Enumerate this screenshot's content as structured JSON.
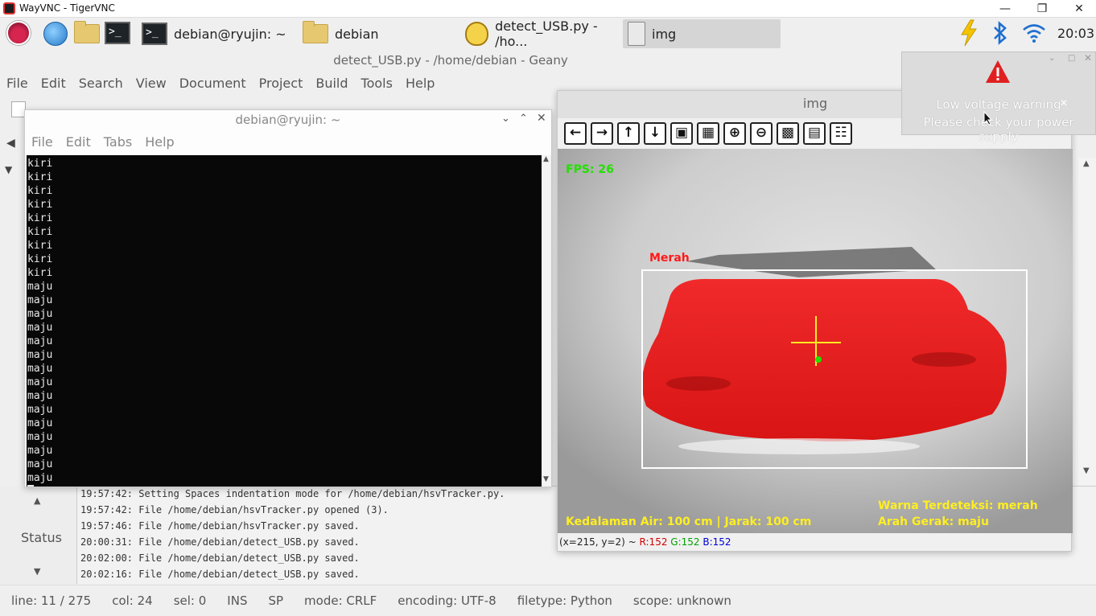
{
  "vnc": {
    "title": "WayVNC - TigerVNC"
  },
  "panel": {
    "tasks": [
      {
        "label": "debian@ryujin: ~"
      },
      {
        "label": "debian"
      },
      {
        "label": "detect_USB.py - /ho..."
      },
      {
        "label": "img"
      }
    ],
    "clock": "20:03"
  },
  "geany": {
    "title": "detect_USB.py - /home/debian - Geany",
    "menu": [
      "File",
      "Edit",
      "Search",
      "View",
      "Document",
      "Project",
      "Build",
      "Tools",
      "Help"
    ],
    "status_tab": "Status",
    "log": [
      "19:57:42: Setting Spaces indentation mode for /home/debian/hsvTracker.py.",
      "19:57:42: File /home/debian/hsvTracker.py opened (3).",
      "19:57:46: File /home/debian/hsvTracker.py saved.",
      "20:00:31: File /home/debian/detect_USB.py saved.",
      "20:02:00: File /home/debian/detect_USB.py saved.",
      "20:02:16: File /home/debian/detect_USB.py saved."
    ],
    "statusbar": {
      "line": "line: 11 / 275",
      "col": "col: 24",
      "sel": "sel: 0",
      "ins": "INS",
      "sp": "SP",
      "mode": "mode: CRLF",
      "encoding": "encoding: UTF-8",
      "filetype": "filetype: Python",
      "scope": "scope: unknown"
    }
  },
  "terminal": {
    "title": "debian@ryujin: ~",
    "menu": [
      "File",
      "Edit",
      "Tabs",
      "Help"
    ],
    "lines": [
      "kiri",
      "kiri",
      "kiri",
      "kiri",
      "kiri",
      "kiri",
      "kiri",
      "kiri",
      "kiri",
      "maju",
      "maju",
      "maju",
      "maju",
      "maju",
      "maju",
      "maju",
      "maju",
      "maju",
      "maju",
      "maju",
      "maju",
      "maju",
      "maju",
      "maju"
    ]
  },
  "imgwin": {
    "title": "img",
    "fps": "FPS: 26",
    "box_label": "Merah",
    "depth_text": "Kedalaman Air: 100 cm | Jarak: 100 cm",
    "color_text": "Warna Terdeteksi: merah",
    "direction_text": "Arah Gerak: maju",
    "status_coords": "(x=215, y=2) ~",
    "r": "R:152",
    "g": "G:152",
    "b": "B:152"
  },
  "notification": {
    "line1": "Low voltage warning",
    "line2": "Please check your power supply"
  },
  "colors": {
    "accent_red": "#ff1a1a",
    "overlay_green": "#22e000",
    "overlay_yellow": "#ffee22"
  }
}
